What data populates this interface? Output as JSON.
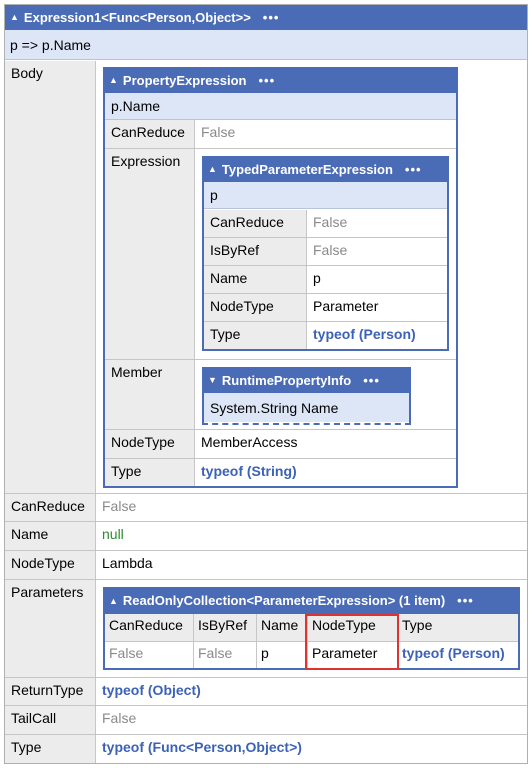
{
  "root": {
    "header": "Expression1<Func<Person,Object>>",
    "summary": "p => p.Name",
    "labels": {
      "body": "Body",
      "can_reduce": "CanReduce",
      "name": "Name",
      "node_type": "NodeType",
      "parameters": "Parameters",
      "return_type": "ReturnType",
      "tail_call": "TailCall",
      "type": "Type"
    },
    "values": {
      "can_reduce": "False",
      "name": "null",
      "node_type": "Lambda",
      "return_type": "typeof (Object)",
      "tail_call": "False",
      "type": "typeof (Func<Person,Object>)"
    }
  },
  "property_expression": {
    "header": "PropertyExpression",
    "summary": "p.Name",
    "labels": {
      "can_reduce": "CanReduce",
      "expression": "Expression",
      "member": "Member",
      "node_type": "NodeType",
      "type": "Type"
    },
    "values": {
      "can_reduce": "False",
      "node_type": "MemberAccess",
      "type": "typeof (String)"
    }
  },
  "typed_parameter": {
    "header": "TypedParameterExpression",
    "summary": "p",
    "labels": {
      "can_reduce": "CanReduce",
      "is_by_ref": "IsByRef",
      "name": "Name",
      "node_type": "NodeType",
      "type": "Type"
    },
    "values": {
      "can_reduce": "False",
      "is_by_ref": "False",
      "name": "p",
      "node_type": "Parameter",
      "type": "typeof (Person)"
    }
  },
  "runtime_property": {
    "header": "RuntimePropertyInfo",
    "summary": "System.String Name"
  },
  "collection": {
    "header": "ReadOnlyCollection<ParameterExpression> (1 item)",
    "columns": [
      "CanReduce",
      "IsByRef",
      "Name",
      "NodeType",
      "Type"
    ],
    "row": [
      "False",
      "False",
      "p",
      "Parameter",
      "typeof (Person)"
    ]
  },
  "menu_dots": "•••",
  "colors": {
    "header": "#4a6bb5",
    "summary": "#dde6f7",
    "highlight": "#e0332f"
  }
}
